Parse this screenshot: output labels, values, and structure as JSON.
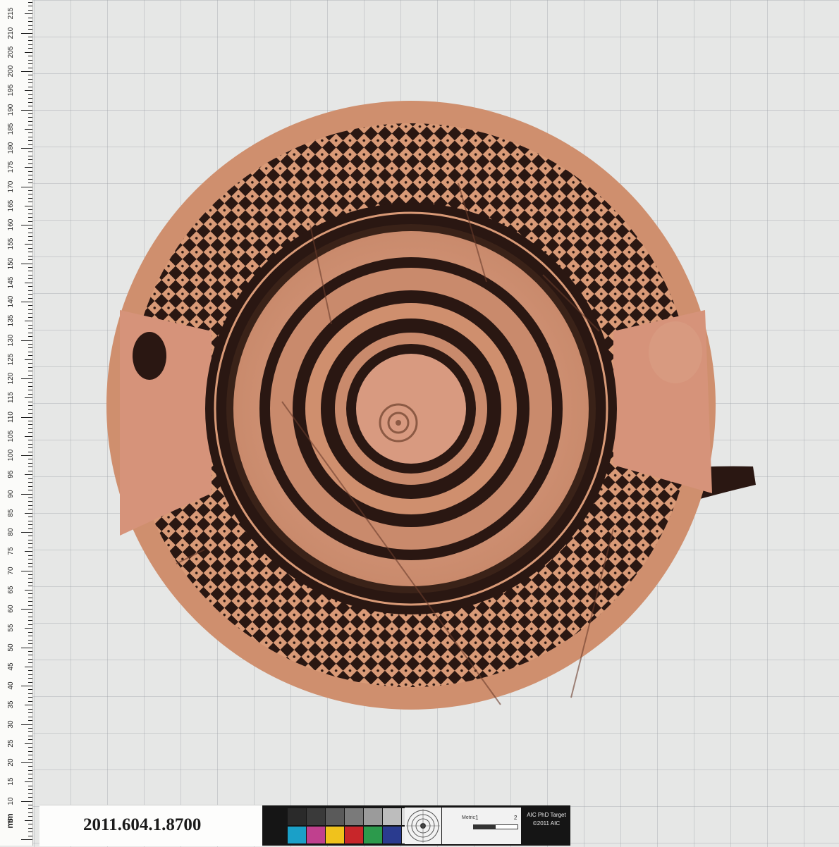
{
  "accession_number": "2011.604.1.8700",
  "ruler": {
    "unit": "mm",
    "labels": [
      "5",
      "10",
      "15",
      "20",
      "25",
      "30",
      "35",
      "40",
      "45",
      "50",
      "55",
      "60",
      "65",
      "70",
      "75",
      "80",
      "85",
      "90",
      "95",
      "100",
      "105",
      "110",
      "115",
      "120",
      "125",
      "130",
      "135",
      "140",
      "145",
      "150",
      "155",
      "160",
      "165",
      "170",
      "175",
      "180",
      "185",
      "190",
      "195",
      "200",
      "205",
      "210",
      "215"
    ]
  },
  "color_target": {
    "metric_label": "Metric",
    "scale_marks": [
      "1",
      "2"
    ],
    "name": "AIC PhD Target",
    "copyright": "©2011 AIC",
    "swatch_colors_top": [
      "#2a2a2a",
      "#3a3a3a",
      "#5a5a5a",
      "#7a7a7a",
      "#9b9b9b",
      "#bdbdbd",
      "#dcdcdc"
    ],
    "swatch_colors_bottom": [
      "#1aa0c8",
      "#c0408e",
      "#f0c21c",
      "#c8262a",
      "#2c9a4c",
      "#2a3b8f",
      "#ececec"
    ]
  },
  "artifact": {
    "description_icon": "pottery-plate-icon",
    "clay_color": "#cf8f6e",
    "glaze_color": "#2a1712"
  }
}
